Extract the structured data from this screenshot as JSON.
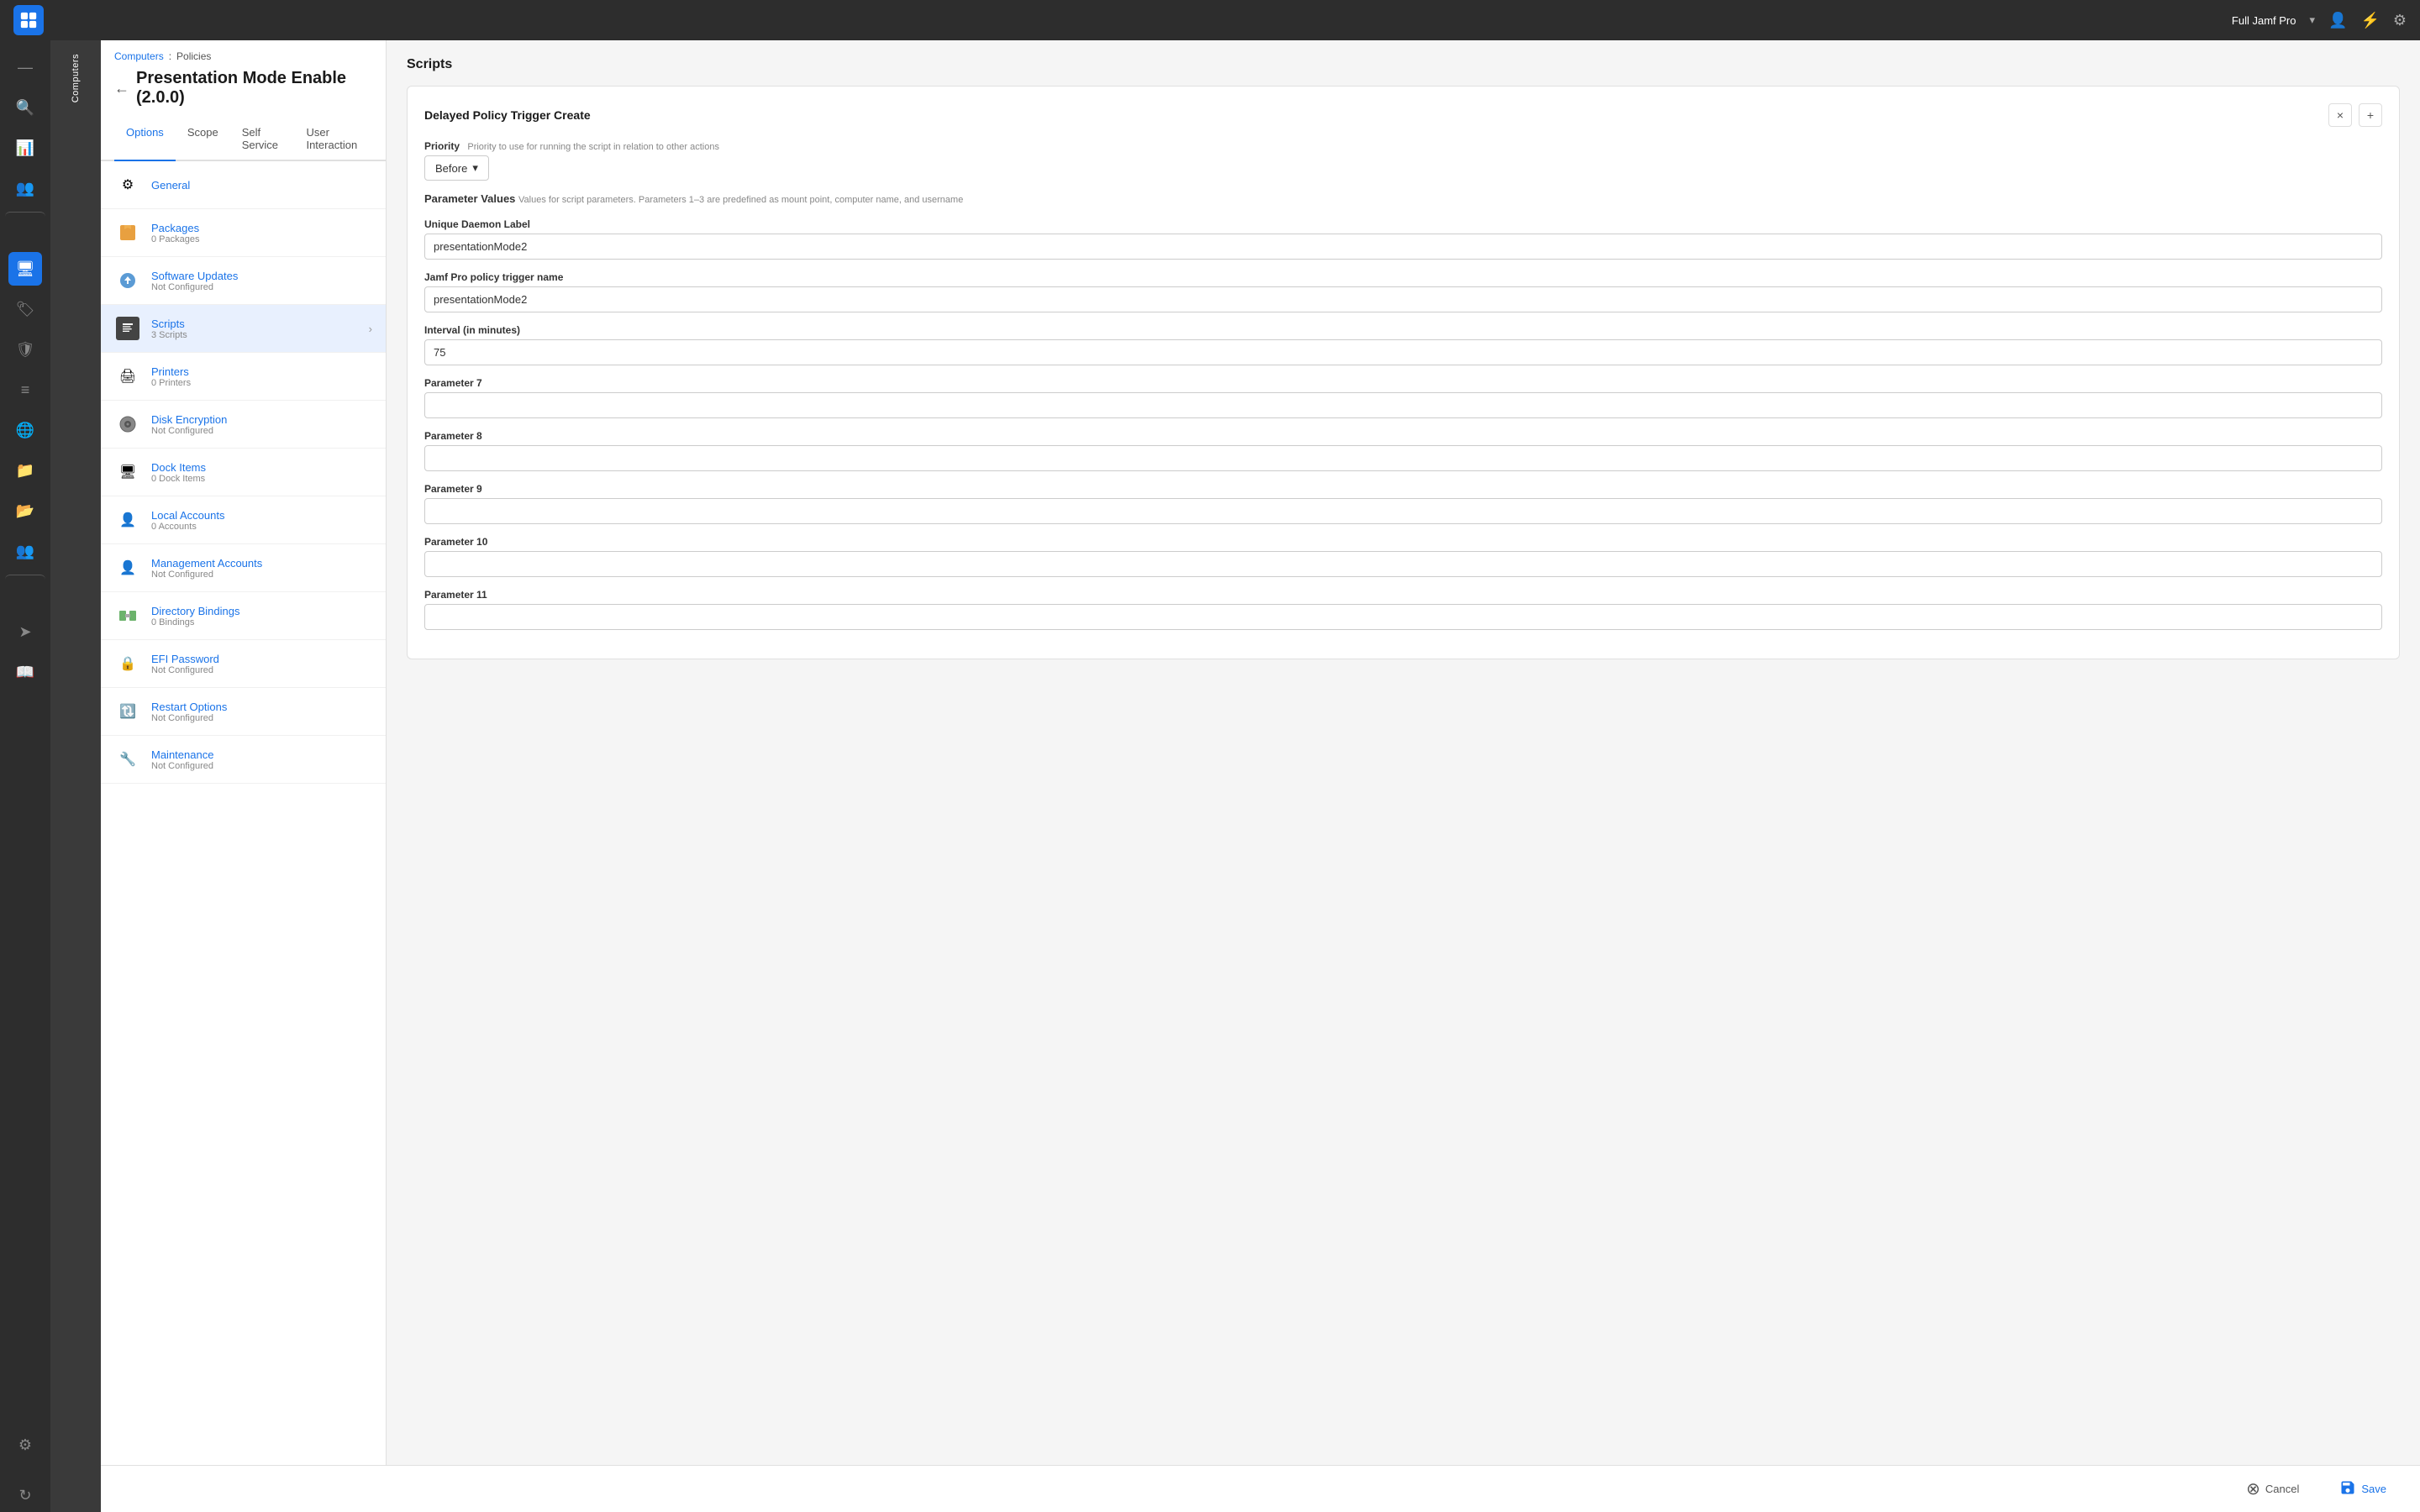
{
  "topbar": {
    "app_name": "Full Jamf Pro",
    "dropdown_arrow": "▾"
  },
  "breadcrumb": {
    "parent": "Computers",
    "separator": ":",
    "current": "Policies"
  },
  "page_title": "Presentation Mode Enable (2.0.0)",
  "tabs": [
    {
      "id": "options",
      "label": "Options",
      "active": true
    },
    {
      "id": "scope",
      "label": "Scope",
      "active": false
    },
    {
      "id": "self-service",
      "label": "Self Service",
      "active": false
    },
    {
      "id": "user-interaction",
      "label": "User Interaction",
      "active": false
    }
  ],
  "sidebar_items": [
    {
      "id": "general",
      "title": "General",
      "sub": "",
      "icon": "⚙"
    },
    {
      "id": "packages",
      "title": "Packages",
      "sub": "0 Packages",
      "icon": "📦"
    },
    {
      "id": "software-updates",
      "title": "Software Updates",
      "sub": "Not Configured",
      "icon": "🔄"
    },
    {
      "id": "scripts",
      "title": "Scripts",
      "sub": "3 Scripts",
      "icon": "📝",
      "active": true,
      "arrow": true
    },
    {
      "id": "printers",
      "title": "Printers",
      "sub": "0 Printers",
      "icon": "🖨"
    },
    {
      "id": "disk-encryption",
      "title": "Disk Encryption",
      "sub": "Not Configured",
      "icon": "💿"
    },
    {
      "id": "dock-items",
      "title": "Dock Items",
      "sub": "0 Dock Items",
      "icon": "🖥"
    },
    {
      "id": "local-accounts",
      "title": "Local Accounts",
      "sub": "0 Accounts",
      "icon": "👤"
    },
    {
      "id": "management-accounts",
      "title": "Management Accounts",
      "sub": "Not Configured",
      "icon": "👤"
    },
    {
      "id": "directory-bindings",
      "title": "Directory Bindings",
      "sub": "0 Bindings",
      "icon": "🔗"
    },
    {
      "id": "efi-password",
      "title": "EFI Password",
      "sub": "Not Configured",
      "icon": "🔒"
    },
    {
      "id": "restart-options",
      "title": "Restart Options",
      "sub": "Not Configured",
      "icon": "🔃"
    },
    {
      "id": "maintenance",
      "title": "Maintenance",
      "sub": "Not Configured",
      "icon": "🔧"
    }
  ],
  "content": {
    "section_title": "Scripts",
    "script_card": {
      "title": "Delayed Policy Trigger Create",
      "priority_label": "Priority",
      "priority_hint": "Priority to use for running the script in relation to other actions",
      "priority_value": "Before",
      "param_section_label": "Parameter Values",
      "param_section_hint": "Values for script parameters. Parameters 1–3 are predefined as mount point, computer name, and username",
      "fields": [
        {
          "id": "unique-daemon-label",
          "label": "Unique Daemon Label",
          "value": "presentationMode2",
          "placeholder": ""
        },
        {
          "id": "jamf-pro-trigger",
          "label": "Jamf Pro policy trigger name",
          "value": "presentationMode2",
          "placeholder": ""
        },
        {
          "id": "interval",
          "label": "Interval (in minutes)",
          "value": "75",
          "placeholder": ""
        },
        {
          "id": "param7",
          "label": "Parameter 7",
          "value": "",
          "placeholder": ""
        },
        {
          "id": "param8",
          "label": "Parameter 8",
          "value": "",
          "placeholder": ""
        },
        {
          "id": "param9",
          "label": "Parameter 9",
          "value": "",
          "placeholder": ""
        },
        {
          "id": "param10",
          "label": "Parameter 10",
          "value": "",
          "placeholder": ""
        },
        {
          "id": "param11",
          "label": "Parameter 11",
          "value": "",
          "placeholder": ""
        }
      ]
    }
  },
  "bottom_bar": {
    "cancel_label": "Cancel",
    "save_label": "Save"
  },
  "nav_label": "Computers",
  "icons": {
    "back": "←",
    "chevron_down": "▾",
    "close": "×",
    "plus": "+",
    "cancel_circle": "⊗",
    "save_disk": "💾"
  }
}
